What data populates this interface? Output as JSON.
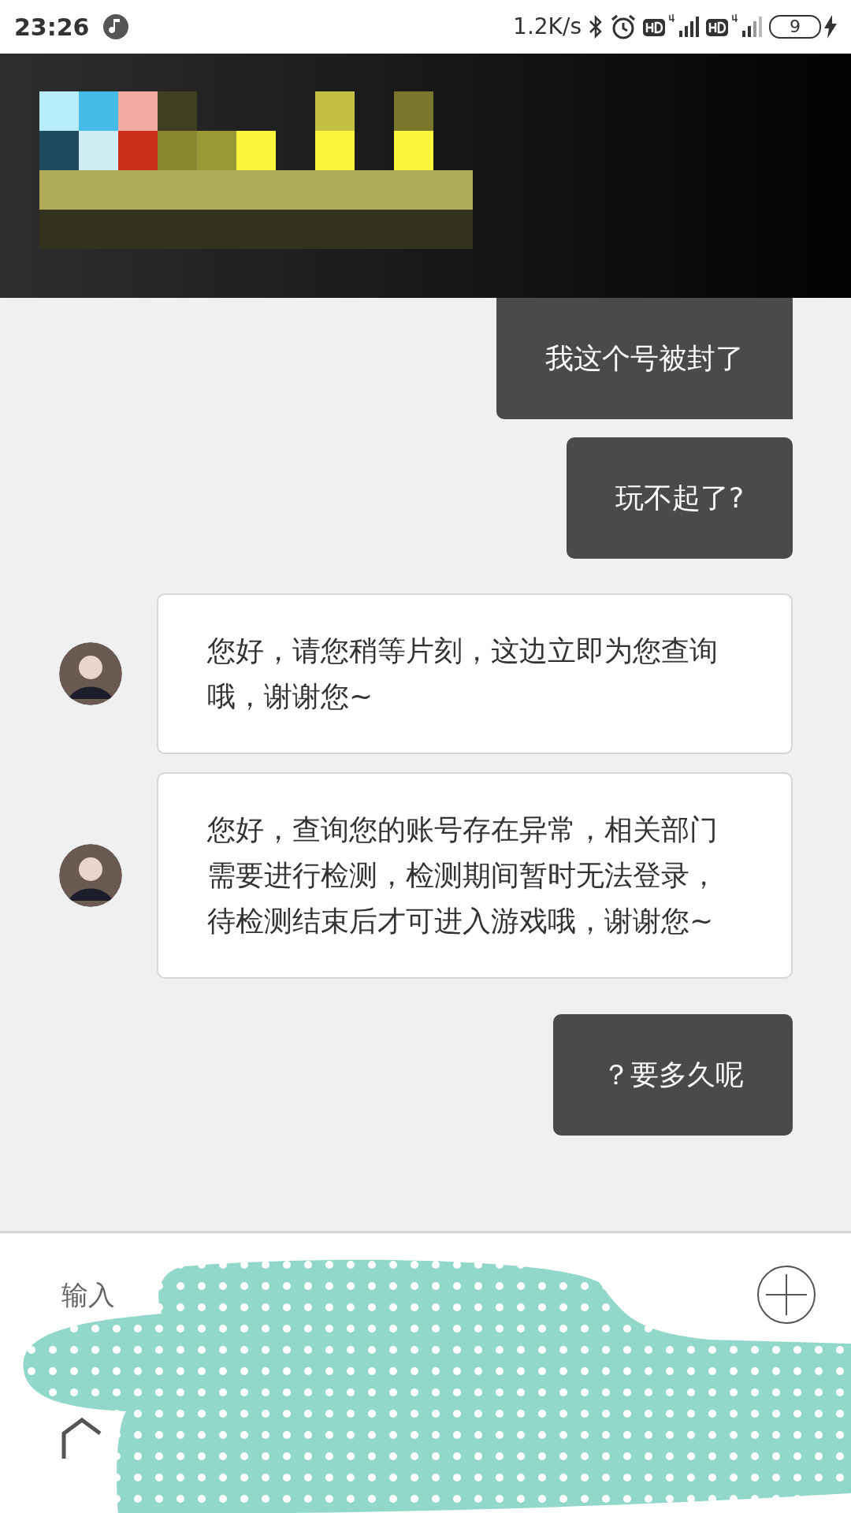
{
  "status_bar": {
    "time": "23:26",
    "net_speed": "1.2K/s",
    "battery": "9"
  },
  "messages": [
    {
      "kind": "sent",
      "text": "我这个号被封了"
    },
    {
      "kind": "sent",
      "text": "玩不起了?"
    },
    {
      "kind": "received",
      "text": "您好，请您稍等片刻，这边立即为您查询哦，谢谢您~"
    },
    {
      "kind": "received",
      "text": "您好，查询您的账号存在异常，相关部门需要进行检测，检测期间暂时无法登录，待检测结束后才可进入游戏哦，谢谢您~"
    },
    {
      "kind": "sent",
      "text": "？要多久呢"
    }
  ],
  "composer": {
    "placeholder": "输入"
  }
}
